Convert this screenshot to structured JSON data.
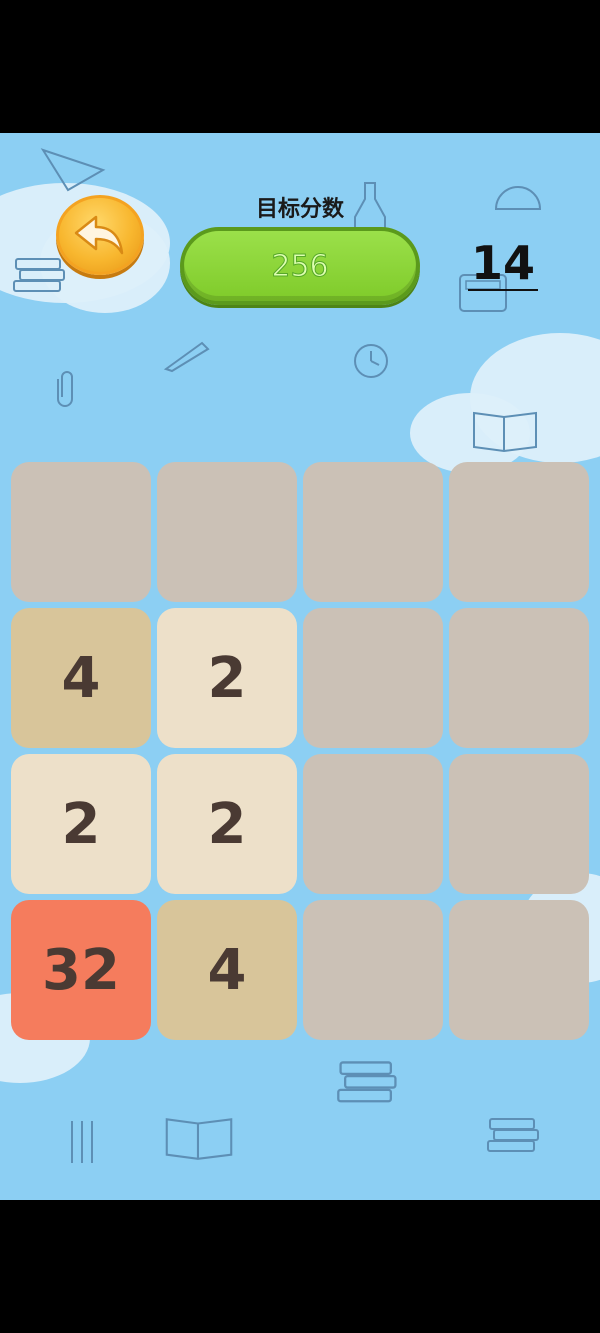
{
  "header": {
    "target_label": "目标分数",
    "target_score": "256",
    "move_count": "14"
  },
  "board": {
    "rows": [
      [
        "",
        "",
        "",
        ""
      ],
      [
        "4",
        "2",
        "",
        ""
      ],
      [
        "2",
        "2",
        "",
        ""
      ],
      [
        "32",
        "4",
        "",
        ""
      ]
    ]
  },
  "colors": {
    "background": "#8ccff3",
    "empty_tile": "#cbc1b6",
    "tile_2": "#ede0c9",
    "tile_4": "#d8c59a",
    "tile_32": "#f57c5d",
    "target_pill": "#8fd63a",
    "back_button": "#f8b72f"
  },
  "icons": {
    "back": "undo-arrow-icon"
  }
}
